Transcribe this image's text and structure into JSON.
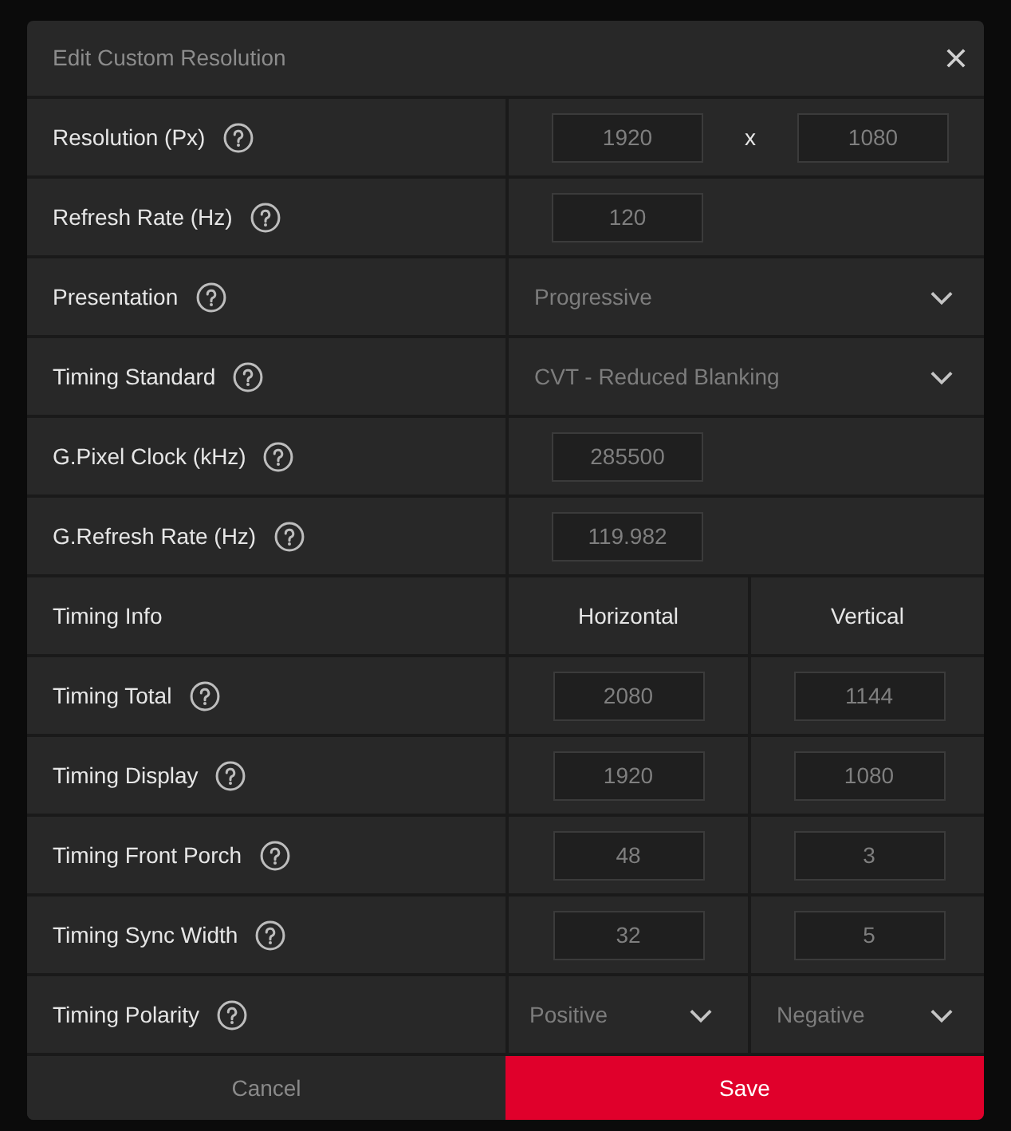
{
  "dialog": {
    "title": "Edit Custom Resolution"
  },
  "rows": [
    {
      "kind": "pair",
      "label": "Resolution (Px)",
      "first": "1920",
      "separator": "x",
      "second": "1080"
    },
    {
      "kind": "input",
      "label": "Refresh Rate (Hz)",
      "value": "120"
    },
    {
      "kind": "dropdown",
      "label": "Presentation",
      "value": "Progressive"
    },
    {
      "kind": "dropdown",
      "label": "Timing Standard",
      "value": "CVT - Reduced Blanking"
    },
    {
      "kind": "input",
      "label": "G.Pixel Clock (kHz)",
      "value": "285500"
    },
    {
      "kind": "input",
      "label": "G.Refresh Rate (Hz)",
      "value": "119.982"
    },
    {
      "kind": "header",
      "label": "Timing Info",
      "horizontal": "Horizontal",
      "vertical": "Vertical"
    },
    {
      "kind": "timing",
      "label": "Timing Total",
      "horizontal": "2080",
      "vertical": "1144"
    },
    {
      "kind": "timing",
      "label": "Timing Display",
      "horizontal": "1920",
      "vertical": "1080"
    },
    {
      "kind": "timing",
      "label": "Timing Front Porch",
      "horizontal": "48",
      "vertical": "3"
    },
    {
      "kind": "timing",
      "label": "Timing Sync Width",
      "horizontal": "32",
      "vertical": "5"
    },
    {
      "kind": "timing_dropdown",
      "label": "Timing Polarity",
      "horizontal": "Positive",
      "vertical": "Negative"
    }
  ],
  "buttons": [
    {
      "kind": "secondary",
      "label": "Cancel"
    },
    {
      "kind": "primary",
      "label": "Save"
    }
  ]
}
